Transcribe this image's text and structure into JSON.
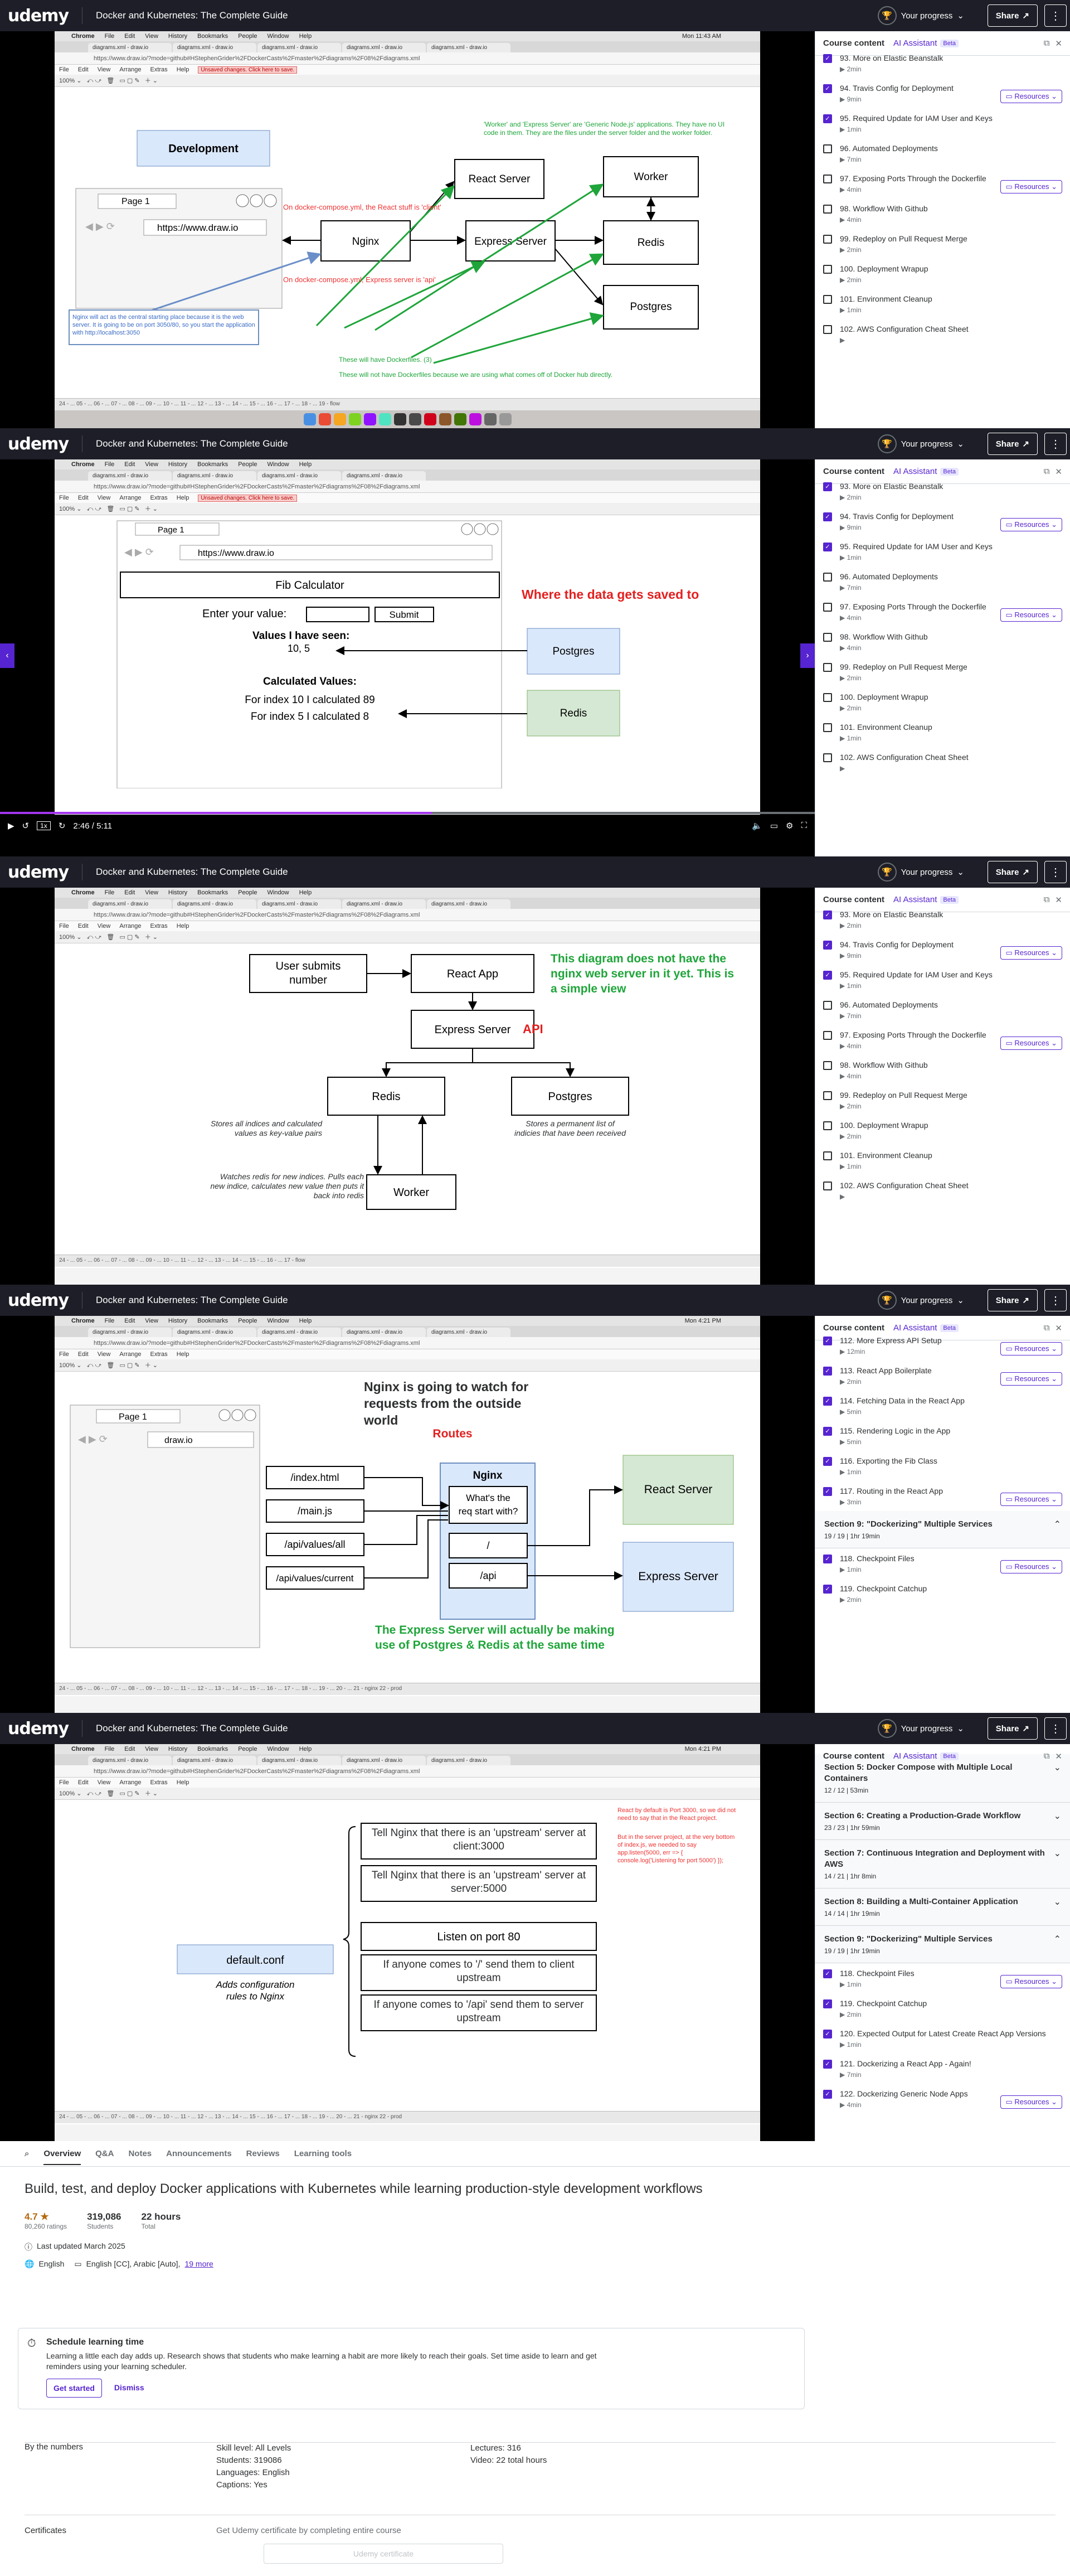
{
  "header": {
    "logo": "udemy",
    "course_title": "Docker and Kubernetes: The Complete Guide",
    "progress_label": "Your progress",
    "share_label": "Share"
  },
  "sidebar": {
    "tab_content": "Course content",
    "tab_ai": "AI Assistant",
    "beta": "Beta",
    "resources_label": "Resources"
  },
  "lectures_a": [
    {
      "t": "93. More on Elastic Beanstalk",
      "d": "2min",
      "c": true,
      "r": false
    },
    {
      "t": "94. Travis Config for Deployment",
      "d": "9min",
      "c": true,
      "r": true
    },
    {
      "t": "95. Required Update for IAM User and Keys",
      "d": "1min",
      "c": true,
      "r": false
    },
    {
      "t": "96. Automated Deployments",
      "d": "7min",
      "c": false,
      "r": false
    },
    {
      "t": "97. Exposing Ports Through the Dockerfile",
      "d": "4min",
      "c": false,
      "r": true
    },
    {
      "t": "98. Workflow With Github",
      "d": "4min",
      "c": false,
      "r": false
    },
    {
      "t": "99. Redeploy on Pull Request Merge",
      "d": "2min",
      "c": false,
      "r": false
    },
    {
      "t": "100. Deployment Wrapup",
      "d": "2min",
      "c": false,
      "r": false
    },
    {
      "t": "101. Environment Cleanup",
      "d": "1min",
      "c": false,
      "r": false
    },
    {
      "t": "102. AWS Configuration Cheat Sheet",
      "d": "",
      "c": false,
      "r": false
    }
  ],
  "lectures_b": [
    {
      "t": "112. More Express API Setup",
      "d": "12min",
      "c": true,
      "r": true
    },
    {
      "t": "113. React App Boilerplate",
      "d": "2min",
      "c": true,
      "r": true
    },
    {
      "t": "114. Fetching Data in the React App",
      "d": "5min",
      "c": true,
      "r": false
    },
    {
      "t": "115. Rendering Logic in the App",
      "d": "5min",
      "c": true,
      "r": false
    },
    {
      "t": "116. Exporting the Fib Class",
      "d": "1min",
      "c": true,
      "r": false
    },
    {
      "t": "117. Routing in the React App",
      "d": "3min",
      "c": true,
      "r": true
    }
  ],
  "section9": {
    "title": "Section 9: \"Dockerizing\" Multiple Services",
    "sub": "19 / 19 | 1hr 19min"
  },
  "lectures_c": [
    {
      "t": "118. Checkpoint Files",
      "d": "1min",
      "c": true,
      "r": true
    },
    {
      "t": "119. Checkpoint Catchup",
      "d": "2min",
      "c": true,
      "r": false
    }
  ],
  "sections_e": [
    {
      "t": "Section 5: Docker Compose with Multiple Local Containers",
      "s": "12 / 12 | 53min"
    },
    {
      "t": "Section 6: Creating a Production-Grade Workflow",
      "s": "23 / 23 | 1hr 59min"
    },
    {
      "t": "Section 7: Continuous Integration and Deployment with AWS",
      "s": "14 / 21 | 1hr 8min"
    },
    {
      "t": "Section 8: Building a Multi-Container Application",
      "s": "14 / 14 | 1hr 19min"
    }
  ],
  "lectures_e": [
    {
      "t": "118. Checkpoint Files",
      "d": "1min",
      "c": true,
      "r": true
    },
    {
      "t": "119. Checkpoint Catchup",
      "d": "2min",
      "c": true,
      "r": false
    },
    {
      "t": "120. Expected Output for Latest Create React App Versions",
      "d": "1min",
      "c": true,
      "r": false
    },
    {
      "t": "121. Dockerizing a React App - Again!",
      "d": "7min",
      "c": true,
      "r": false
    },
    {
      "t": "122. Dockerizing Generic Node Apps",
      "d": "4min",
      "c": true,
      "r": true
    }
  ],
  "player": {
    "time": "2:46 / 5:11",
    "speed": "1x"
  },
  "mac": {
    "menus": [
      "Chrome",
      "File",
      "Edit",
      "View",
      "History",
      "Bookmarks",
      "People",
      "Window",
      "Help"
    ],
    "clock1": "Mon 11:43 AM",
    "clock4": "Mon 4:21 PM",
    "url": "https://www.draw.io/?mode=github#HStephenGrider%2FDockerCasts%2Fmaster%2Fdiagrams%2F08%2Fdiagrams.xml",
    "drawmenu": [
      "File",
      "Edit",
      "View",
      "Arrange",
      "Extras",
      "Help"
    ],
    "unsaved": "Unsaved changes. Click here to save."
  },
  "d1": {
    "development": "Development",
    "page1": "Page 1",
    "url": "https://www.draw.io",
    "nginx": "Nginx",
    "react": "React Server",
    "express": "Express Server",
    "worker": "Worker",
    "redis": "Redis",
    "postgres": "Postgres",
    "n1": "On docker-compose.yml, the React stuff is 'client'",
    "n2": "On docker-compose.yml, Express server is 'api'",
    "n3": "'Worker' and 'Express Server' are 'Generic Node.js' applications. They have no UI code in them. They are the files under the server folder and the worker folder.",
    "n4": "These will have Dockerfiles. (3)",
    "n5": "These will not have Dockerfiles because we are using what comes off of Docker hub directly.",
    "n6": "Nginx will act as the central starting place because it is the web server. It is going to be on port 3050/80, so you start the application with http://localhost:3050"
  },
  "d2": {
    "page1": "Page 1",
    "url": "https://www.draw.io",
    "fib": "Fib Calculator",
    "enter": "Enter your value:",
    "submit": "Submit",
    "seen": "Values I have seen:",
    "seen_vals": "10, 5",
    "calc": "Calculated Values:",
    "calc1": "For index 10 I calculated 89",
    "calc2": "For index 5 I calculated 8",
    "postgres": "Postgres",
    "redis": "Redis",
    "where": "Where the data gets saved to"
  },
  "d3": {
    "user": "User submits number",
    "react": "React App",
    "express": "Express Server",
    "api": "API",
    "redis": "Redis",
    "postgres": "Postgres",
    "worker": "Worker",
    "note": "This diagram does not have the nginx web server in it yet. This is a simple view",
    "redis_note": "Stores all indices and calculated values as key-value pairs",
    "pg_note": "Stores a permanent list of indicies that have been received",
    "worker_note": "Watches redis for new indices. Pulls each new indice, calculates new value then puts it back into redis"
  },
  "d4": {
    "page1": "Page 1",
    "url": "draw.io",
    "title": "Nginx is going to watch for requests from the outside world",
    "routes": "Routes",
    "nginx": "Nginx",
    "question": "What's the req start with?",
    "slash": "/",
    "api": "/api",
    "r1": "/index.html",
    "r2": "/main.js",
    "r3": "/api/values/all",
    "r4": "/api/values/current",
    "react": "React Server",
    "express": "Express Server",
    "note": "The Express Server will actually be making use of Postgres & Redis at the same time"
  },
  "d5": {
    "conf": "default.conf",
    "conf_note": "Adds configuration rules to Nginx",
    "l1": "Tell Nginx that there is an 'upstream' server at client:3000",
    "l2": "Tell Nginx that there is an 'upstream' server at server:5000",
    "l3": "Listen on port 80",
    "l4": "If anyone comes to '/' send them to client upstream",
    "l5": "If anyone comes to '/api' send them to server upstream",
    "red": "React by default is Port 3000, so we did not need to say that in the React project.",
    "red2": "But in the server project, at the very bottom of index.js, we needed to say app.listen(5000, err => { console.log('Listening for port 5000') });"
  },
  "below": {
    "tabs": [
      "Overview",
      "Q&A",
      "Notes",
      "Announcements",
      "Reviews",
      "Learning tools"
    ],
    "headline": "Build, test, and deploy Docker applications with Kubernetes while learning production-style development workflows",
    "rating": "4.7",
    "ratings": "80,260 ratings",
    "students": "319,086",
    "students_l": "Students",
    "hours": "22 hours",
    "hours_l": "Total",
    "updated": "Last updated March 2025",
    "lang": "English",
    "cc": "English [CC], Arabic [Auto],",
    "more": "19 more",
    "sched_t": "Schedule learning time",
    "sched_d": "Learning a little each day adds up. Research shows that students who make learning a habit are more likely to reach their goals. Set time aside to learn and get reminders using your learning scheduler.",
    "start": "Get started",
    "dismiss": "Dismiss",
    "by": "By the numbers",
    "skill": "Skill level: All Levels",
    "stu": "Students: 319086",
    "langs": "Languages: English",
    "caps": "Captions: Yes",
    "lects": "Lectures: 316",
    "vid": "Video: 22 total hours",
    "cert": "Certificates",
    "cert_d": "Get Udemy certificate by completing entire course",
    "cert_b": "Udemy certificate"
  }
}
